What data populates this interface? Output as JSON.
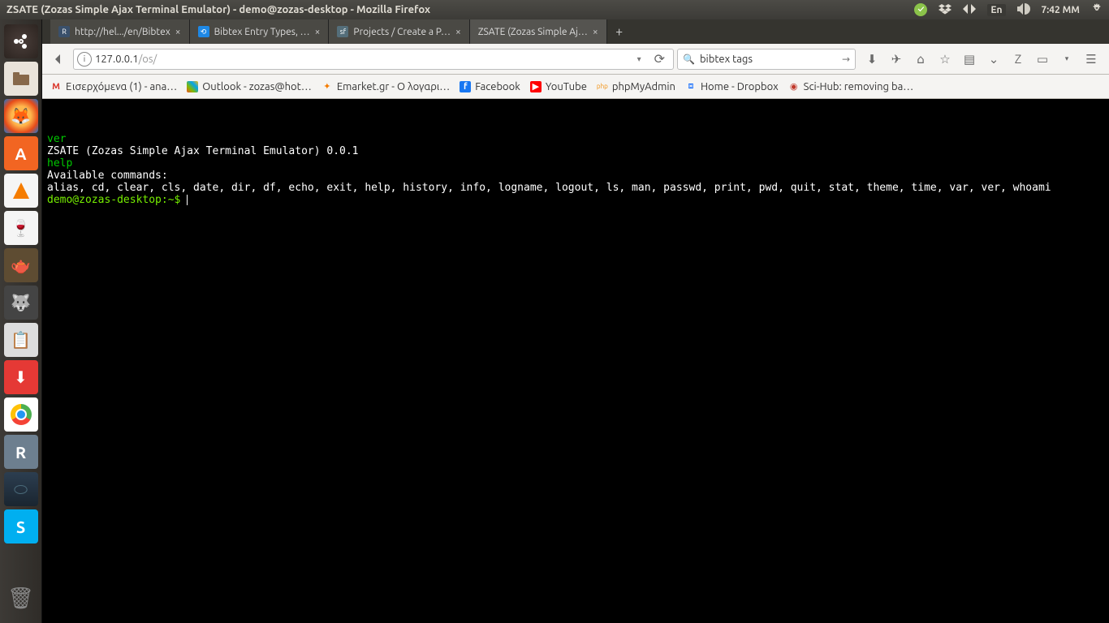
{
  "titlebar": {
    "title": "ZSATE (Zozas Simple Ajax Terminal Emulator) - demo@zozas-desktop - Mozilla Firefox"
  },
  "tray": {
    "language": "En",
    "clock": "7:42 MM"
  },
  "tabs": [
    {
      "label": "http://hel.../en/Bibtex",
      "favicon_letter": "R",
      "favicon_bg": "#3a506b"
    },
    {
      "label": "Bibtex Entry Types, …",
      "favicon_letter": "●",
      "favicon_bg": "#1e88e5"
    },
    {
      "label": "Projects / Create a P…",
      "favicon_letter": "sf",
      "favicon_bg": "#546e7a"
    },
    {
      "label": "ZSATE (Zozas Simple Aj…",
      "favicon_letter": "",
      "favicon_bg": "transparent"
    }
  ],
  "url": {
    "host": "127.0.0.1",
    "path": "/os/"
  },
  "search": {
    "value": "bibtex tags"
  },
  "bookmarks": [
    {
      "label": "Εισερχόμενα (1) - ana…",
      "color": "#d93025",
      "glyph": "M"
    },
    {
      "label": "Outlook - zozas@hot…",
      "color": "",
      "glyph": "⊞"
    },
    {
      "label": "Emarket.gr - Ο λογαρι…",
      "color": "#f57c00",
      "glyph": "✦"
    },
    {
      "label": "Facebook",
      "color": "#1877f2",
      "glyph": "f"
    },
    {
      "label": "YouTube",
      "color": "#ff0000",
      "glyph": "▶"
    },
    {
      "label": "phpMyAdmin",
      "color": "#f29111",
      "glyph": "php"
    },
    {
      "label": "Home - Dropbox",
      "color": "#0061ff",
      "glyph": "⧈"
    },
    {
      "label": "Sci-Hub: removing ba…",
      "color": "#c0392b",
      "glyph": "◉"
    }
  ],
  "terminal": {
    "l1_cmd": "ver",
    "l2_out": "ZSATE (Zozas Simple Ajax Terminal Emulator) 0.0.1",
    "l3_cmd": "help",
    "l4_out": "Available commands:",
    "l5_out": "alias, cd, clear, cls, date, dir, df, echo, exit, help, history, info, logname, logout, ls, man, passwd, print, pwd, quit, stat, theme, time, var, ver, whoami",
    "prompt": "demo@zozas-desktop:~$ "
  }
}
